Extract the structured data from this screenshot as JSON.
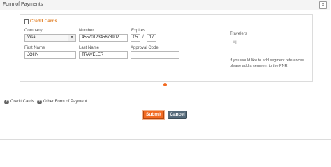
{
  "window": {
    "title": "Form of Payments",
    "close_symbol": "×"
  },
  "credit_card_section": {
    "header": "Credit Cards",
    "company": {
      "label": "Company",
      "value": "Visa"
    },
    "number": {
      "label": "Number",
      "value": "4557012345678902"
    },
    "expires": {
      "label": "Expires",
      "month": "05",
      "separator": "/",
      "year": "17"
    },
    "first_name": {
      "label": "First Name",
      "value": "JOHN"
    },
    "last_name": {
      "label": "Last Name",
      "value": "TRAVELER"
    },
    "approval_code": {
      "label": "Approval Code",
      "value": ""
    }
  },
  "travelers": {
    "label": "Travelers",
    "value": "All",
    "note": "If you would like to add segment references please add a segment to the PNR."
  },
  "add_options": [
    {
      "label": "Credit Cards",
      "symbol": "+"
    },
    {
      "label": "Other Form of Payment",
      "symbol": "+"
    }
  ],
  "buttons": {
    "submit": "Submit",
    "cancel": "Cancel"
  },
  "colors": {
    "accent": "#e07b1f",
    "submit_bg": "#f26a21",
    "cancel_bg": "#556a7a"
  }
}
